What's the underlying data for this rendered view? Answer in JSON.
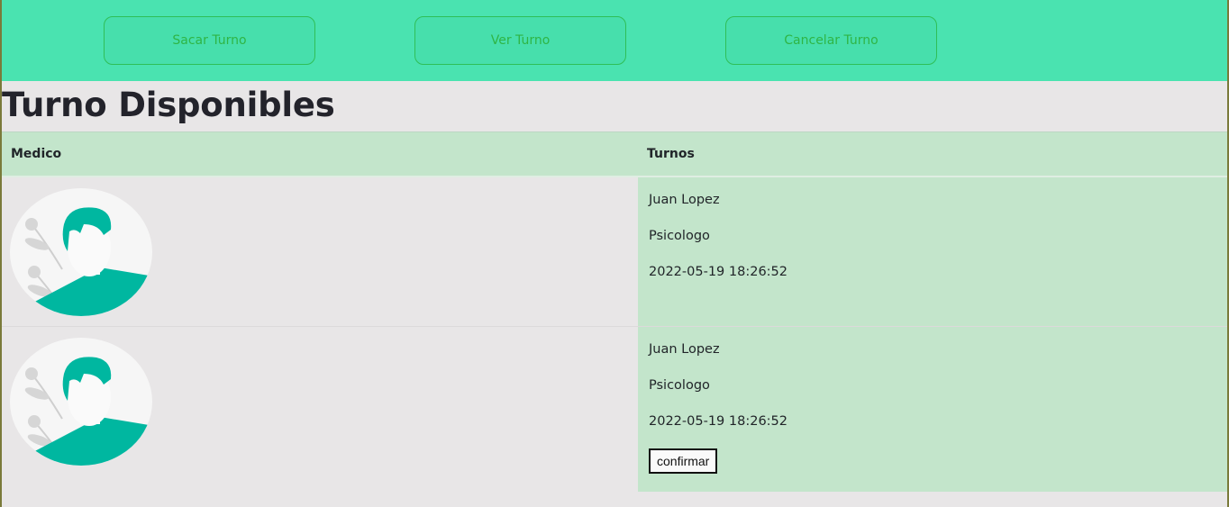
{
  "nav": {
    "buttons": [
      "Sacar Turno",
      "Ver Turno",
      "Cancelar Turno"
    ]
  },
  "page_title": "Turno Disponibles",
  "table": {
    "headers": [
      "Medico",
      "Turnos"
    ],
    "rows": [
      {
        "name": "Juan Lopez",
        "specialty": "Psicologo",
        "datetime": "2022-05-19 18:26:52",
        "action": ""
      },
      {
        "name": "Juan Lopez",
        "specialty": "Psicologo",
        "datetime": "2022-05-19 18:26:52",
        "action": "confirmar"
      }
    ]
  },
  "icons": {
    "avatar": "doctor-avatar-icon"
  },
  "colors": {
    "topbar": "#4ae3b0",
    "accent_teal": "#00b7a0",
    "table_green": "#c3e5cb",
    "button_text": "#2fb545"
  }
}
